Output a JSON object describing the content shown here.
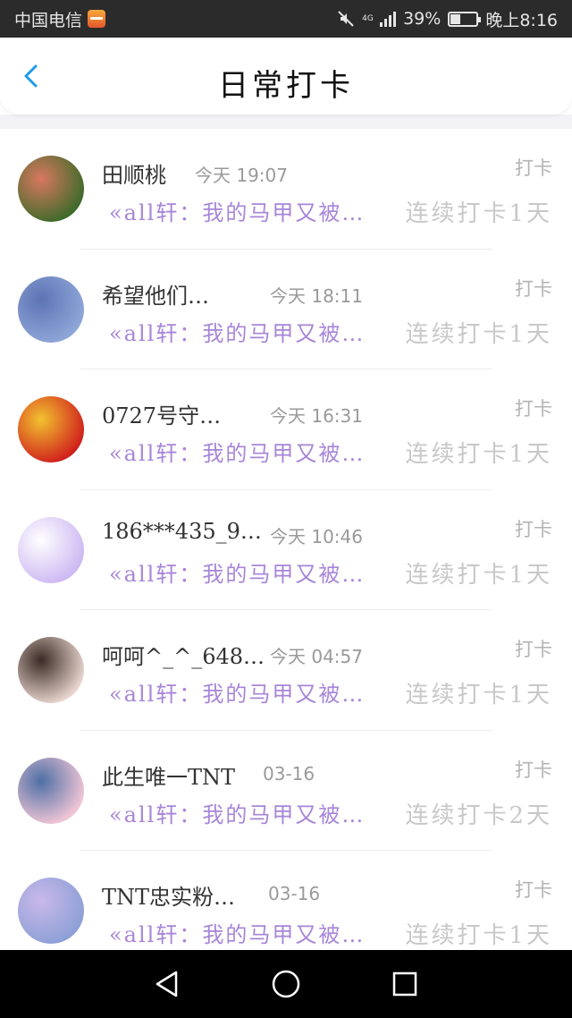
{
  "status_bar": {
    "carrier": "中国电信",
    "network": "4G",
    "battery": "39%",
    "battery_level": 0.39,
    "time": "晚上8:16"
  },
  "header": {
    "title": "日常打卡",
    "back_icon": "chevron-left-icon"
  },
  "items": [
    {
      "name": "田顺桃",
      "time": "今天 19:07",
      "tag": "打卡",
      "message": "«all轩：我的马甲又被…",
      "streak": "连续打卡1天",
      "avatar_colors": [
        "#3e6b2a",
        "#d9785f"
      ]
    },
    {
      "name": "希望他们…",
      "time": "今天 18:11",
      "tag": "打卡",
      "message": "«all轩：我的马甲又被…",
      "streak": "连续打卡1天",
      "avatar_colors": [
        "#8fa6d8",
        "#5d74b5"
      ]
    },
    {
      "name": "0727号守…",
      "time": "今天 16:31",
      "tag": "打卡",
      "message": "«all轩：我的马甲又被…",
      "streak": "连续打卡1天",
      "avatar_colors": [
        "#d0201c",
        "#f2c230"
      ]
    },
    {
      "name": "186***435_9…",
      "time": "今天 10:46",
      "tag": "打卡",
      "message": "«all轩：我的马甲又被…",
      "streak": "连续打卡1天",
      "avatar_colors": [
        "#cdb8f3",
        "#ffffff"
      ]
    },
    {
      "name": "呵呵^_^_648…",
      "time": "今天 04:57",
      "tag": "打卡",
      "message": "«all轩：我的马甲又被…",
      "streak": "连续打卡1天",
      "avatar_colors": [
        "#e9d6cf",
        "#3b2a25"
      ]
    },
    {
      "name": "此生唯一TNT",
      "time": "03-16",
      "tag": "打卡",
      "message": "«all轩：我的马甲又被…",
      "streak": "连续打卡2天",
      "avatar_colors": [
        "#f2c6d6",
        "#4d6fa5"
      ]
    },
    {
      "name": "TNT忠实粉…",
      "time": "03-16",
      "tag": "打卡",
      "message": "«all轩：我的马甲又被…",
      "streak": "连续打卡1天",
      "avatar_colors": [
        "#8da0d6",
        "#c9b8ea"
      ]
    }
  ],
  "nav": {
    "back_icon": "triangle-back-icon",
    "home_icon": "circle-home-icon",
    "recents_icon": "square-recents-icon"
  },
  "colors": {
    "message_purple": "#a786d8",
    "status_bar_bg": "#2b2b2b",
    "back_arrow": "#1e9be8"
  }
}
